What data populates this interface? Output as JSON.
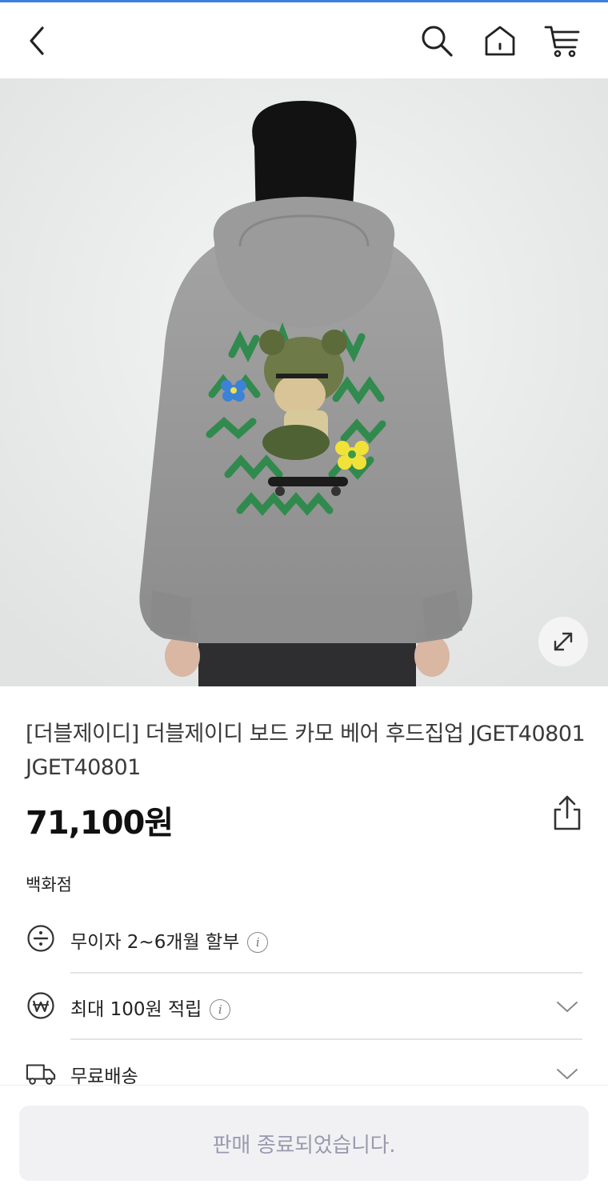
{
  "header": {
    "back_icon": "chevron-left-icon",
    "search_icon": "search-icon",
    "home_icon": "home-icon",
    "cart_icon": "cart-icon"
  },
  "hero": {
    "image_subject": "gray hoodie back view with green bear skateboard graphic",
    "expand_icon": "expand-icon"
  },
  "product": {
    "title": "[더블제이디] 더블제이디 보드 카모 베어 후드집업 JGET40801 JGET40801",
    "price": "71,100원",
    "share_icon": "share-icon",
    "store_type": "백화점"
  },
  "benefits": [
    {
      "label": "무이자 2~6개월 할부",
      "icon": "divide-icon",
      "has_info": true,
      "has_chevron": false
    },
    {
      "label": "최대 100원 적립",
      "icon": "won-point-icon",
      "has_info": true,
      "has_chevron": true
    },
    {
      "label": "무료배송",
      "icon": "truck-icon",
      "has_info": false,
      "has_chevron": true
    }
  ],
  "bottom": {
    "soldout_label": "판매 종료되었습니다."
  },
  "colors": {
    "accent_line": "#3d7fe0",
    "disabled_button_bg": "#f1f1f4",
    "disabled_button_text": "#9a9aae"
  }
}
